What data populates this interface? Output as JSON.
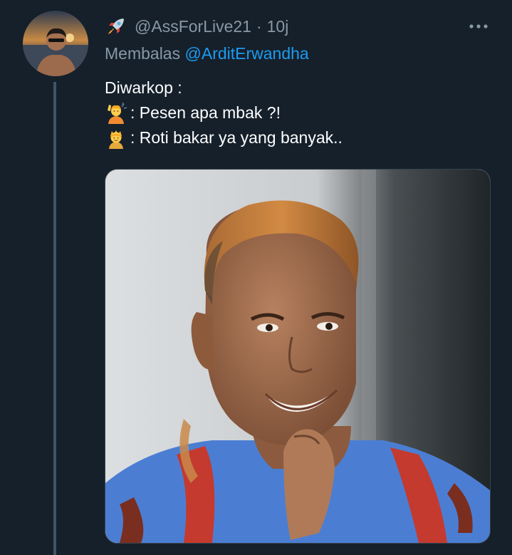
{
  "tweet": {
    "handle": "@AssForLive21",
    "separator": "·",
    "time": "10j",
    "replying_prefix": "Membalas",
    "replying_to": "@ArditErwandha",
    "lines": [
      "Diwarkop :",
      ": Pesen apa mbak ?!",
      ": Roti bakar ya yang banyak.."
    ]
  },
  "icons": {
    "badge": "rocket-icon",
    "more": "more-horizontal-icon",
    "line2_emoji": "person-raising-hand-emoji",
    "line3_emoji": "princess-emoji"
  },
  "colors": {
    "background": "#15202b",
    "secondary_text": "#8899a6",
    "link": "#1d9bf0",
    "thread_line": "#425465"
  }
}
